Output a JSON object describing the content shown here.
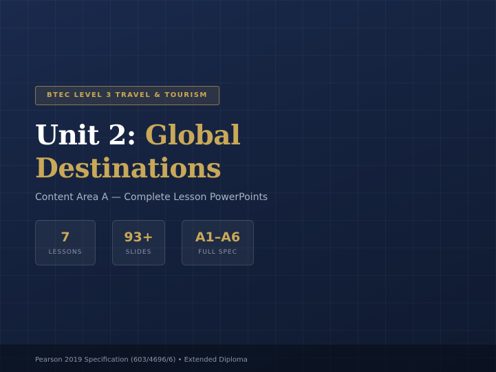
{
  "badge": "BTEC LEVEL 3 TRAVEL & TOURISM",
  "title": {
    "prefix": "Unit 2:",
    "line1_highlight": "Global",
    "line2_highlight": "Destinations"
  },
  "subtitle": "Content Area A — Complete Lesson PowerPoints",
  "stats": [
    {
      "value": "7",
      "label": "LESSONS"
    },
    {
      "value": "93+",
      "label": "SLIDES"
    },
    {
      "value": "A1–A6",
      "label": "FULL SPEC"
    }
  ],
  "footer": "Pearson 2019 Specification (603/4696/6) • Extended Diploma",
  "colors": {
    "accent": "#c9a858",
    "background": "#15223e",
    "muted_text": "#aab4c6"
  }
}
